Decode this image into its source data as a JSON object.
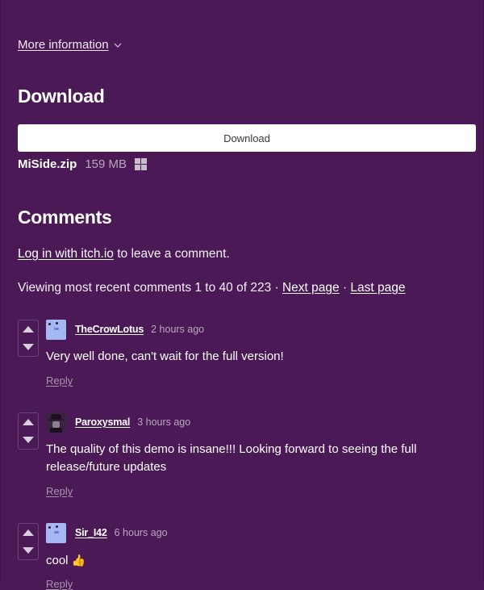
{
  "more_info": {
    "label": "More information"
  },
  "download": {
    "heading": "Download",
    "button_label": "Download",
    "file_name": "MiSide.zip",
    "file_size": "159 MB",
    "platform_icon": "windows-icon"
  },
  "comments": {
    "heading": "Comments",
    "login_link": "Log in with itch.io",
    "login_suffix": " to leave a comment.",
    "viewing_text": "Viewing most recent comments 1 to 40 of 223 · ",
    "next_page": "Next page",
    "separator": " · ",
    "last_page": "Last page",
    "items": [
      {
        "user": "TheCrowLotus",
        "time": "2 hours ago",
        "body": "Very well done, can't wait for the full version!",
        "reply": "Reply",
        "avatar": "blob-avatar"
      },
      {
        "user": "Paroxysmal",
        "time": "3 hours ago",
        "body": "The quality of this demo is insane!!! Looking forward to seeing the full release/future updates",
        "reply": "Reply",
        "avatar": "dark-avatar"
      },
      {
        "user": "Sir_I42",
        "time": "6 hours ago",
        "body": "cool",
        "emoji": "👍",
        "reply": "Reply",
        "avatar": "blob-avatar"
      }
    ]
  },
  "colors": {
    "background": "#4b1a56",
    "muted_text": "#b9a6bf",
    "button_bg": "#ffffff"
  }
}
